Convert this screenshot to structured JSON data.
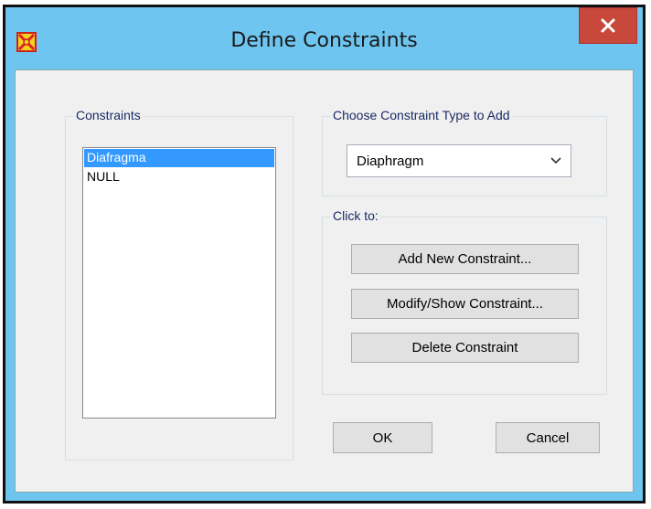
{
  "window": {
    "title": "Define Constraints",
    "close_symbol": "✕",
    "app_icon": "sap2000-icon"
  },
  "constraints_group": {
    "label": "Constraints",
    "items": [
      {
        "label": "Diafragma",
        "selected": true
      },
      {
        "label": "NULL",
        "selected": false
      }
    ]
  },
  "type_group": {
    "label": "Choose Constraint Type to Add",
    "selected_type": "Diaphragm"
  },
  "click_group": {
    "label": "Click to:",
    "add_label": "Add New Constraint...",
    "modify_label": "Modify/Show Constraint...",
    "delete_label": "Delete Constraint"
  },
  "footer": {
    "ok_label": "OK",
    "cancel_label": "Cancel"
  },
  "colors": {
    "frame": "#6ec6f0",
    "close": "#c9483c",
    "selection": "#3399ff",
    "legend_text": "#1a2a66"
  }
}
